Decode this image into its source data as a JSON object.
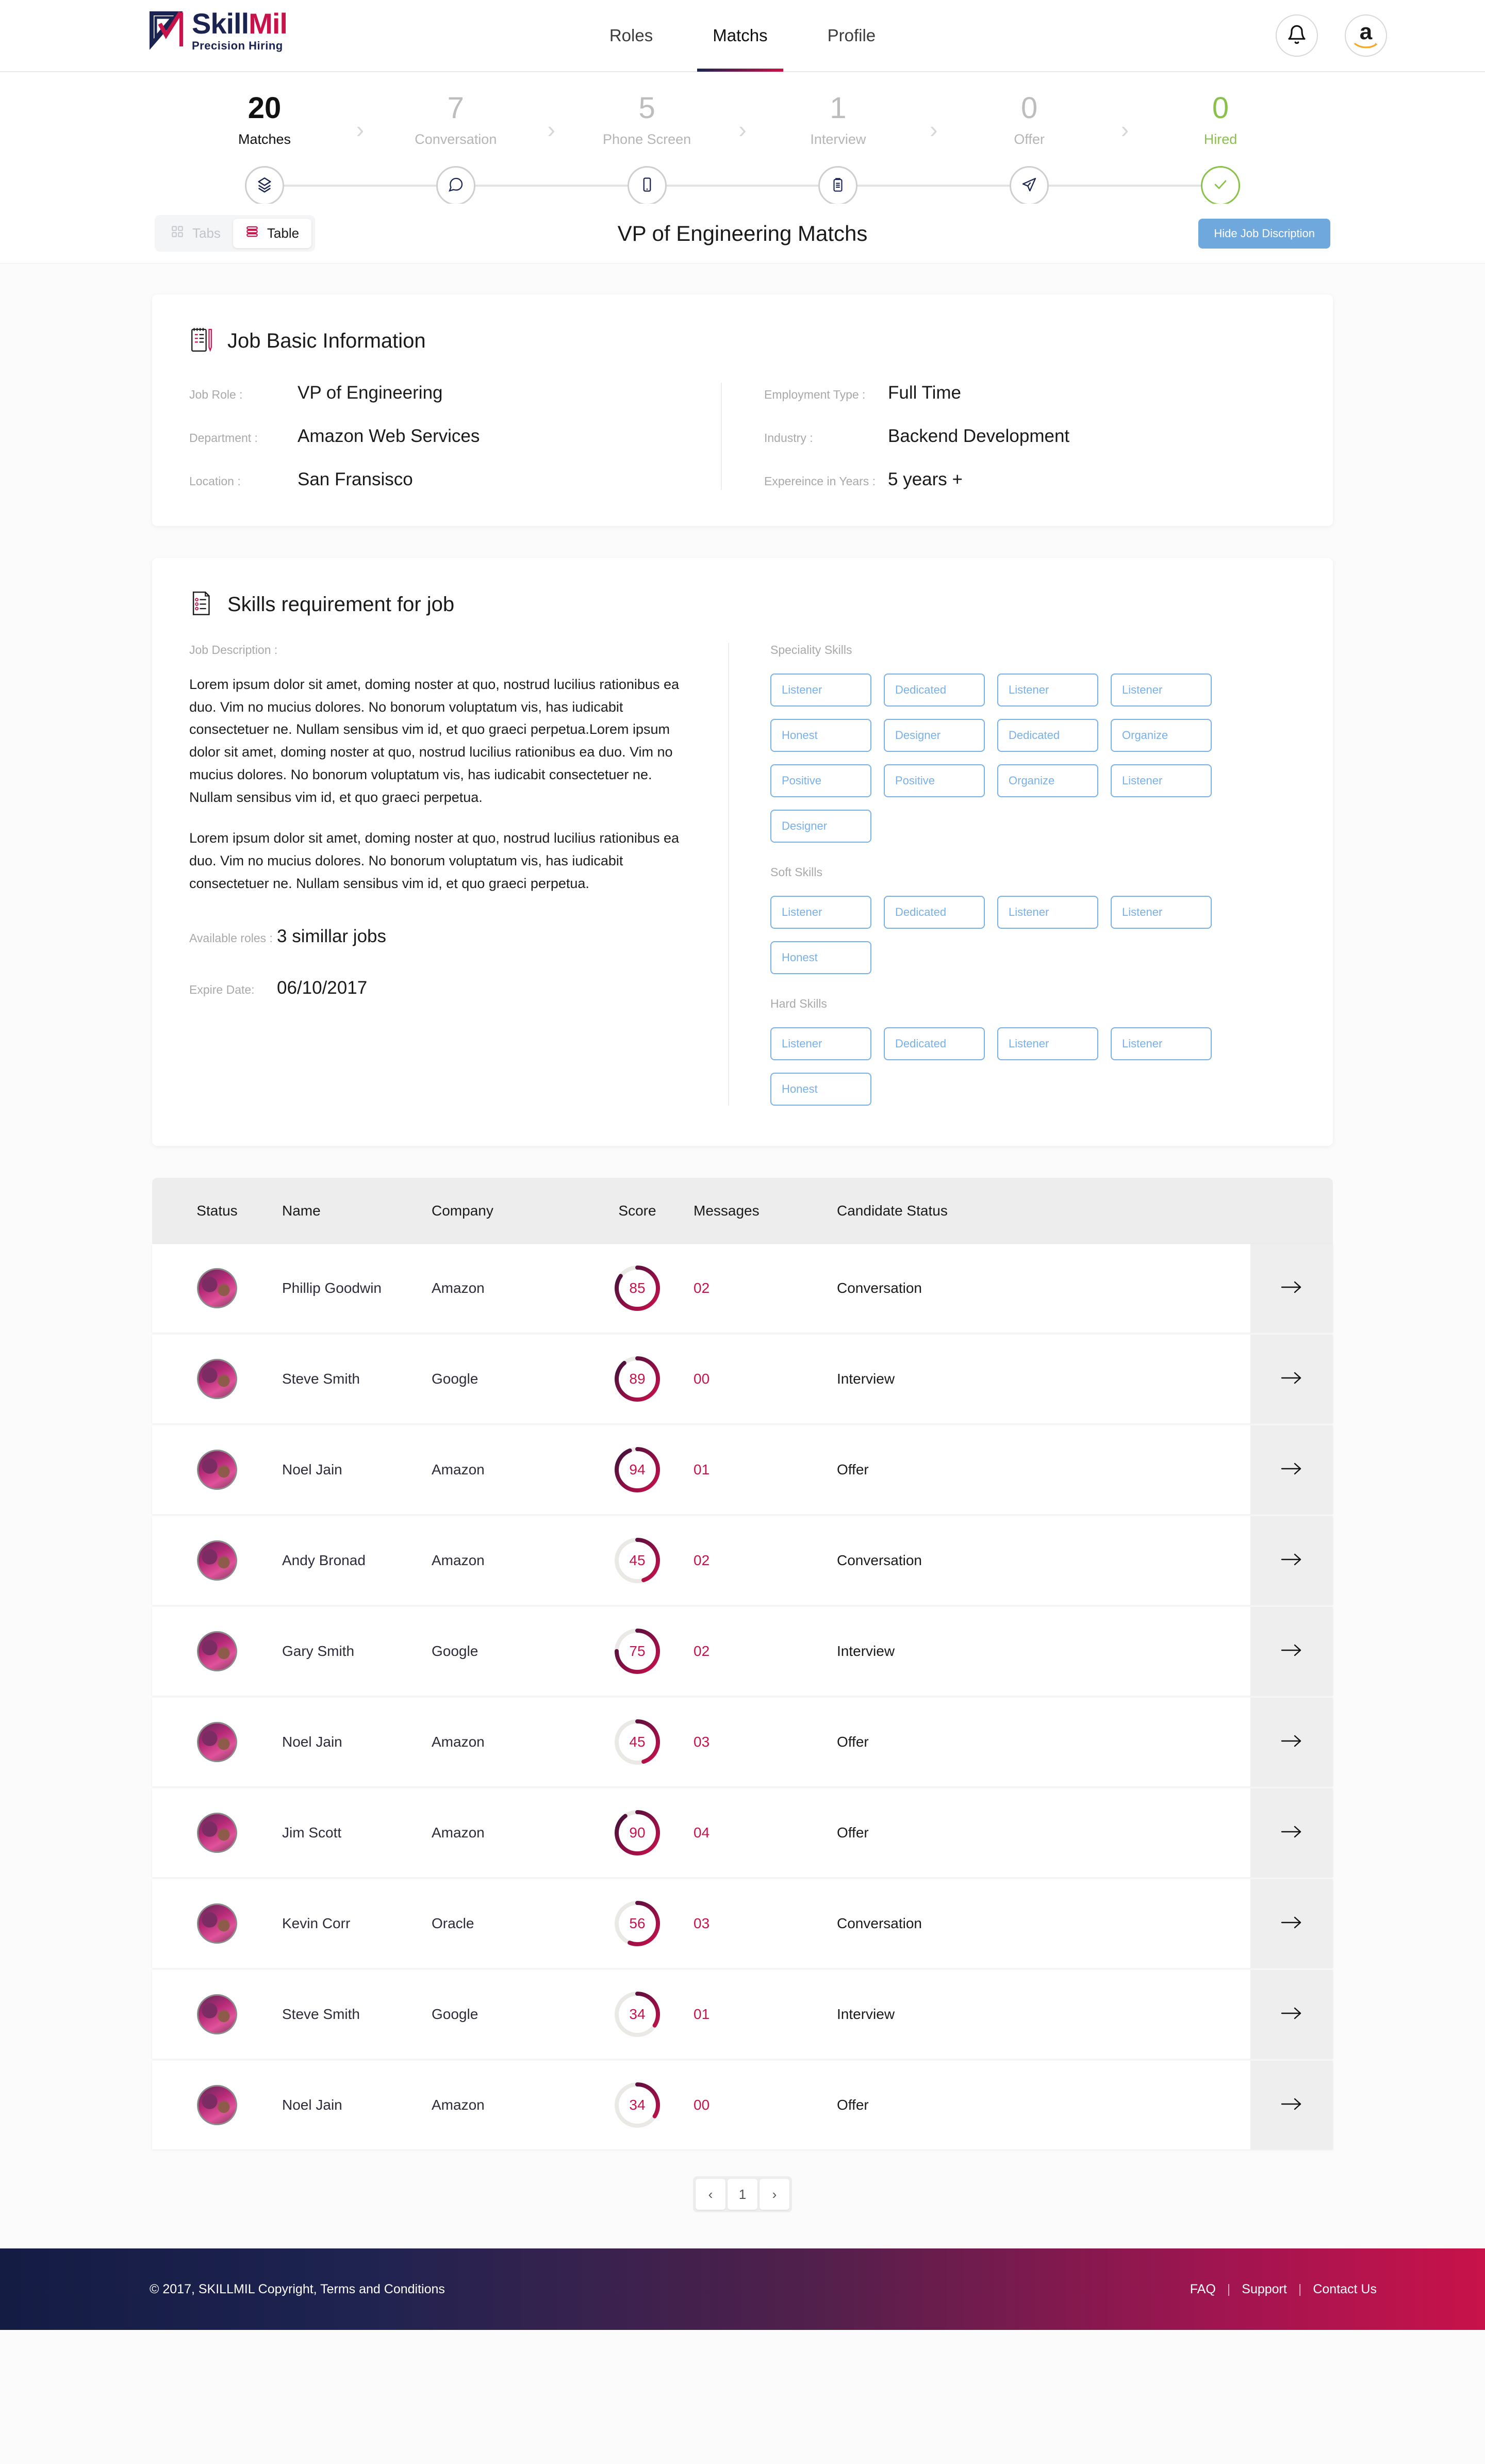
{
  "brand": {
    "name_part1": "Skill",
    "name_part2": "Mil",
    "tagline": "Precision  Hiring"
  },
  "nav": {
    "items": [
      {
        "label": "Roles",
        "active": false
      },
      {
        "label": "Matchs",
        "active": true
      },
      {
        "label": "Profile",
        "active": false
      }
    ]
  },
  "header_actions": {
    "notification_icon": "bell-icon",
    "avatar_icon": "amazon-logo-icon",
    "avatar_letter": "a"
  },
  "pipeline": {
    "stages": [
      {
        "count": "20",
        "label": "Matches",
        "icon": "layers-icon",
        "state": "active"
      },
      {
        "count": "7",
        "label": "Conversation",
        "icon": "chat-bubble-icon",
        "state": "muted"
      },
      {
        "count": "5",
        "label": "Phone Screen",
        "icon": "mobile-icon",
        "state": "muted"
      },
      {
        "count": "1",
        "label": "Interview",
        "icon": "clipboard-icon",
        "state": "muted"
      },
      {
        "count": "0",
        "label": "Offer",
        "icon": "send-icon",
        "state": "muted"
      },
      {
        "count": "0",
        "label": "Hired",
        "icon": "check-icon",
        "state": "hired"
      }
    ],
    "separator": "›"
  },
  "toolbar": {
    "view_tabs": [
      {
        "label": "Tabs",
        "icon": "grid-icon",
        "active": false
      },
      {
        "label": "Table",
        "icon": "table-icon",
        "active": true
      }
    ],
    "title": "VP of Engineering Matchs",
    "hide_button": "Hide Job Discription"
  },
  "job_basic": {
    "heading": "Job Basic Information",
    "icon": "notepad-pen-icon",
    "left_fields": [
      {
        "label": "Job Role :",
        "value": "VP of Engineering"
      },
      {
        "label": "Department :",
        "value": "Amazon Web Services"
      },
      {
        "label": "Location :",
        "value": "San Fransisco"
      }
    ],
    "right_fields": [
      {
        "label": "Employment Type :",
        "value": "Full Time"
      },
      {
        "label": "Industry :",
        "value": "Backend Development"
      },
      {
        "label": "Expereince in Years :",
        "value": "5 years +"
      }
    ]
  },
  "skills_card": {
    "heading": "Skills requirement for job",
    "icon": "checklist-document-icon",
    "jd_label": "Job Description :",
    "jd_paragraphs": [
      "Lorem ipsum dolor sit amet, doming noster at quo, nostrud lucilius rationibus ea duo. Vim no mucius dolores. No bonorum voluptatum vis, has iudicabit consectetuer ne. Nullam sensibus vim id, et quo graeci perpetua.Lorem ipsum dolor sit amet, doming noster at quo, nostrud lucilius rationibus ea duo. Vim no mucius dolores. No bonorum voluptatum vis, has iudicabit consectetuer ne. Nullam sensibus vim id, et quo graeci perpetua.",
      "Lorem ipsum dolor sit amet, doming noster at quo, nostrud lucilius rationibus ea duo. Vim no mucius dolores. No bonorum voluptatum vis, has iudicabit consectetuer ne. Nullam sensibus vim id, et quo graeci perpetua."
    ],
    "available_roles_label": "Available roles :",
    "available_roles_value": "3 simillar jobs",
    "expire_label": "Expire Date:",
    "expire_value": "06/10/2017",
    "groups": [
      {
        "label": "Speciality Skills",
        "tags": [
          "Listener",
          "Dedicated",
          "Listener",
          "Listener",
          "Honest",
          "Designer",
          "Dedicated",
          "Organize",
          "Positive",
          "Positive",
          "Organize",
          "Listener",
          "Designer"
        ]
      },
      {
        "label": "Soft Skills",
        "tags": [
          "Listener",
          "Dedicated",
          "Listener",
          "Listener",
          "Honest"
        ]
      },
      {
        "label": "Hard Skills",
        "tags": [
          "Listener",
          "Dedicated",
          "Listener",
          "Listener",
          "Honest"
        ]
      }
    ]
  },
  "table": {
    "columns": [
      "Status",
      "Name",
      "Company",
      "Score",
      "Messages",
      "Candidate Status"
    ],
    "rows": [
      {
        "avatar": "user-avatar",
        "name": "Phillip Goodwin",
        "company": "Amazon",
        "score": "85",
        "messages": "02",
        "candidate_status": "Conversation",
        "go": "arrow-right-icon"
      },
      {
        "avatar": "user-avatar",
        "name": "Steve Smith",
        "company": "Google",
        "score": "89",
        "messages": "00",
        "candidate_status": "Interview",
        "go": "arrow-right-icon"
      },
      {
        "avatar": "user-avatar",
        "name": "Noel Jain",
        "company": "Amazon",
        "score": "94",
        "messages": "01",
        "candidate_status": "Offer",
        "go": "arrow-right-icon"
      },
      {
        "avatar": "user-avatar",
        "name": "Andy Bronad",
        "company": "Amazon",
        "score": "45",
        "messages": "02",
        "candidate_status": "Conversation",
        "go": "arrow-right-icon"
      },
      {
        "avatar": "user-avatar",
        "name": "Gary Smith",
        "company": "Google",
        "score": "75",
        "messages": "02",
        "candidate_status": "Interview",
        "go": "arrow-right-icon"
      },
      {
        "avatar": "user-avatar",
        "name": "Noel Jain",
        "company": "Amazon",
        "score": "45",
        "messages": "03",
        "candidate_status": "Offer",
        "go": "arrow-right-icon"
      },
      {
        "avatar": "user-avatar",
        "name": "Jim Scott",
        "company": "Amazon",
        "score": "90",
        "messages": "04",
        "candidate_status": "Offer",
        "go": "arrow-right-icon"
      },
      {
        "avatar": "user-avatar",
        "name": "Kevin Corr",
        "company": "Oracle",
        "score": "56",
        "messages": "03",
        "candidate_status": "Conversation",
        "go": "arrow-right-icon"
      },
      {
        "avatar": "user-avatar",
        "name": "Steve Smith",
        "company": "Google",
        "score": "34",
        "messages": "01",
        "candidate_status": "Interview",
        "go": "arrow-right-icon"
      },
      {
        "avatar": "user-avatar",
        "name": "Noel Jain",
        "company": "Amazon",
        "score": "34",
        "messages": "00",
        "candidate_status": "Offer",
        "go": "arrow-right-icon"
      }
    ]
  },
  "pagination": {
    "prev": "‹",
    "current": "1",
    "next": "›"
  },
  "footer": {
    "copyright": "© 2017, SKILLMIL   Copyright, Terms and Conditions",
    "links": [
      "FAQ",
      "Support",
      "Contact Us"
    ],
    "separator": "|"
  },
  "colors": {
    "brand_navy": "#1b2450",
    "brand_crimson": "#c8124a",
    "accent_blue": "#6fa8dc",
    "tag_blue": "#7ab0e8",
    "hired_green": "#8ac14a"
  }
}
